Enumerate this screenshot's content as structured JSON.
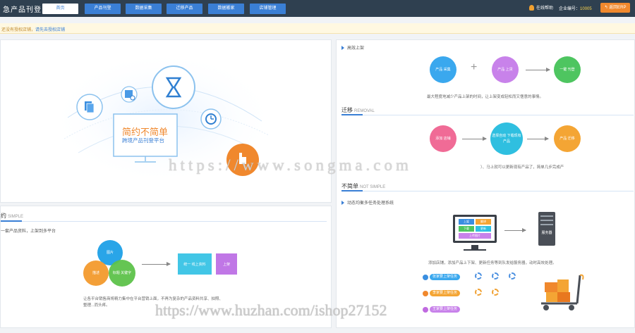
{
  "header": {
    "title": "急产品刊登",
    "tabs": [
      {
        "label": "首页",
        "active": true
      },
      {
        "label": "产品刊登",
        "active": false
      },
      {
        "label": "数据采集",
        "active": false
      },
      {
        "label": "迁移产品",
        "active": false
      },
      {
        "label": "数据搬家",
        "active": false
      },
      {
        "label": "店铺管理",
        "active": false
      }
    ],
    "user_label": "在线帮助",
    "company_label": "企业编号：",
    "company_id": "10005",
    "erp_button": "返回ERP"
  },
  "notice": {
    "text": "还没有授权店铺，",
    "link": "请先去授权店铺"
  },
  "hero": {
    "slogan_main": "简约不简单",
    "slogan_sub": "跨境产品刊登平台"
  },
  "simple": {
    "heading": "约",
    "heading_en": "SIMPLE",
    "desc": "一套产品资料，上架到多平台",
    "circles": [
      "图片",
      "描述",
      "标题 关键字"
    ],
    "box1": "统一 线上资料",
    "box2": "上架",
    "caption_line1": "让各平台销售商将精力集中在平台营销上面，不再为复杂的产品资料共享、拍照、",
    "caption_line2": "整理...而头疼。"
  },
  "right": {
    "upload": {
      "sub": "高效上架",
      "circles": [
        "产品 采集",
        "产品 上货",
        "一键 刊登"
      ],
      "caption": "最大程度地减少产品上架的时间，让上架变成轻松而又惬意的事情。"
    },
    "migrate": {
      "heading": "迁移",
      "heading_en": "REMOVAL",
      "circles": [
        "添加 店铺",
        "选择自动 下载现有 产品",
        "产品 迁移"
      ],
      "caption": "）、马上就可以更新现有产品了，简单几步完成产"
    },
    "notsimple": {
      "heading": "不简单",
      "heading_en": "NOT SIMPLE",
      "sub": "动态均衡多任务处理系统",
      "screen_rows": [
        [
          "上架",
          "翻译"
        ],
        [
          "下载",
          "更新"
        ],
        [
          "上传图片"
        ]
      ],
      "server_label": "服务器",
      "caption": "添加店铺，添加产品上下架、更新任务等到队发给服务器，动时高效处理。",
      "workers": [
        "张家要上架任务",
        "李家要上架任务",
        "王家要上架任务"
      ]
    }
  },
  "watermarks": {
    "top": "https://www.songma.com",
    "bottom": "https://www.huzhan.com/ishop27152"
  },
  "colors": {
    "topbar": "#2f4050",
    "tab_blue": "#3a7fd5",
    "accent_orange": "#f0882d"
  }
}
